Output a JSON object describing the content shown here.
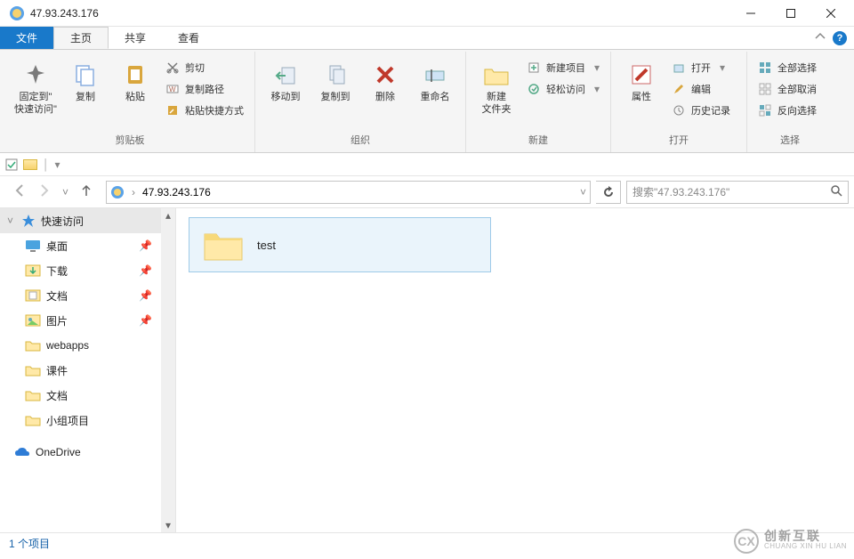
{
  "window": {
    "title": "47.93.243.176"
  },
  "tabs": {
    "file": "文件",
    "home": "主页",
    "share": "共享",
    "view": "查看"
  },
  "ribbon": {
    "clipboard": {
      "label": "剪贴板",
      "pin": "固定到\"\n快速访问\"",
      "copy": "复制",
      "paste": "粘贴",
      "cut": "剪切",
      "copy_path": "复制路径",
      "paste_shortcut": "粘贴快捷方式"
    },
    "organize": {
      "label": "组织",
      "move_to": "移动到",
      "copy_to": "复制到",
      "delete": "删除",
      "rename": "重命名"
    },
    "new": {
      "label": "新建",
      "new_folder": "新建\n文件夹",
      "new_item": "新建项目",
      "easy_access": "轻松访问"
    },
    "open": {
      "label": "打开",
      "properties": "属性",
      "open": "打开",
      "edit": "编辑",
      "history": "历史记录"
    },
    "select": {
      "label": "选择",
      "select_all": "全部选择",
      "select_none": "全部取消",
      "invert": "反向选择"
    }
  },
  "nav": {
    "breadcrumb": "47.93.243.176",
    "search_placeholder": "搜索\"47.93.243.176\""
  },
  "sidebar": {
    "quick_access": "快速访问",
    "items": [
      {
        "label": "桌面",
        "pinned": true,
        "icon": "desktop"
      },
      {
        "label": "下载",
        "pinned": true,
        "icon": "downloads"
      },
      {
        "label": "文档",
        "pinned": true,
        "icon": "documents"
      },
      {
        "label": "图片",
        "pinned": true,
        "icon": "pictures"
      },
      {
        "label": "webapps",
        "pinned": false,
        "icon": "folder"
      },
      {
        "label": "课件",
        "pinned": false,
        "icon": "folder"
      },
      {
        "label": "文档",
        "pinned": false,
        "icon": "folder"
      },
      {
        "label": "小组项目",
        "pinned": false,
        "icon": "folder"
      }
    ],
    "onedrive": "OneDrive"
  },
  "content": {
    "items": [
      {
        "name": "test",
        "type": "folder"
      }
    ]
  },
  "status": {
    "count": "1 个项目"
  },
  "watermark": {
    "cn": "创新互联",
    "en": "CHUANG XIN HU LIAN"
  }
}
